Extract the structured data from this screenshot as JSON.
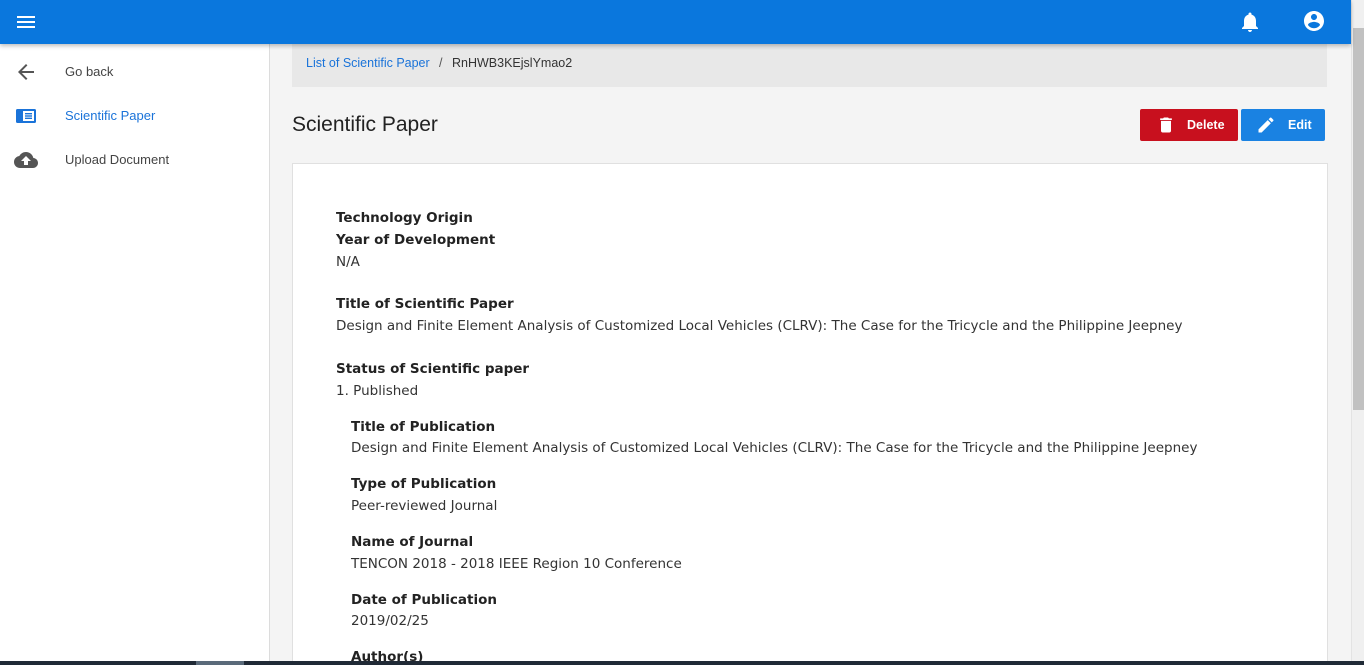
{
  "topbar": {
    "menu_icon": "menu-icon",
    "notifications_icon": "bell-icon",
    "account_icon": "account-circle-icon",
    "color": "#0a77dd"
  },
  "sidebar": {
    "items": [
      {
        "label": "Go back",
        "icon": "arrow-left-icon"
      },
      {
        "label": "Scientific Paper",
        "icon": "book-icon",
        "active": true
      },
      {
        "label": "Upload Document",
        "icon": "cloud-upload-icon"
      }
    ]
  },
  "breadcrumb": {
    "parent": "List of Scientific Paper",
    "separator": "/",
    "current": "RnHWB3KEjslYmao2"
  },
  "page": {
    "title": "Scientific Paper"
  },
  "actions": {
    "delete_label": "Delete",
    "edit_label": "Edit",
    "delete_color": "#c8101e",
    "edit_color": "#1a82e2"
  },
  "details": {
    "technology_origin_label": "Technology Origin",
    "year_label": "Year of Development",
    "year_value": "N/A",
    "title_label": "Title of Scientific Paper",
    "title_value": "Design and Finite Element Analysis of Customized Local Vehicles (CLRV): The Case for the Tricycle and the Philippine Jeepney",
    "status_label": "Status of Scientific paper",
    "status_value": "1. Published",
    "publication": {
      "title_label": "Title of Publication",
      "title_value": "Design and Finite Element Analysis of Customized Local Vehicles (CLRV): The Case for the Tricycle and the Philippine Jeepney",
      "type_label": "Type of Publication",
      "type_value": "Peer-reviewed Journal",
      "journal_label": "Name of Journal",
      "journal_value": "TENCON 2018 - 2018 IEEE Region 10 Conference",
      "date_label": "Date of Publication",
      "date_value": "2019/02/25",
      "authors_label": "Author(s)"
    }
  }
}
